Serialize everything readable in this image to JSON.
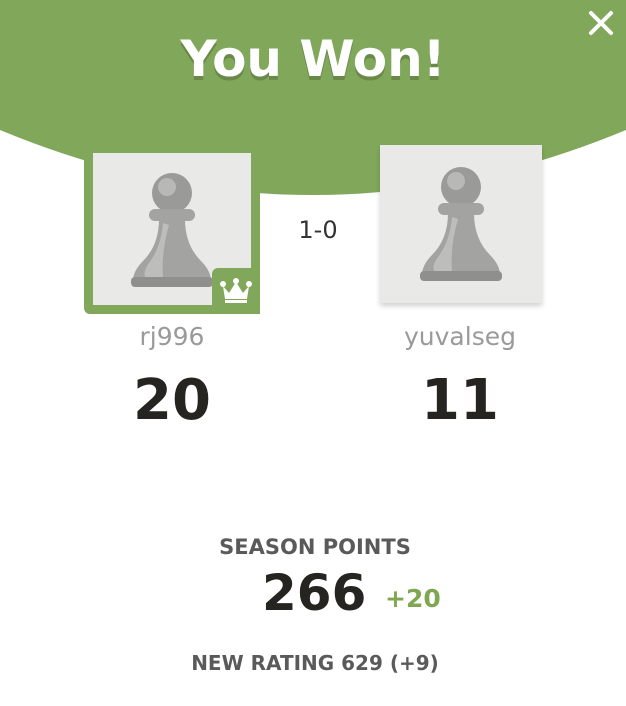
{
  "modal": {
    "title": "You Won!",
    "close_icon": "close-icon",
    "accent_color": "#81a85a"
  },
  "players": [
    {
      "username": "rj996",
      "points": "20",
      "winner": true,
      "badge_icon": "crown-icon",
      "avatar_icon": "pawn-icon"
    },
    {
      "username": "yuvalseg",
      "points": "11",
      "winner": false,
      "avatar_icon": "pawn-icon"
    }
  ],
  "result": {
    "score": "1-0"
  },
  "season": {
    "label": "SEASON POINTS",
    "points": "266",
    "delta": "+20",
    "delta_color": "#7fa650"
  },
  "rating": {
    "text": "NEW RATING 629 (+9)"
  }
}
